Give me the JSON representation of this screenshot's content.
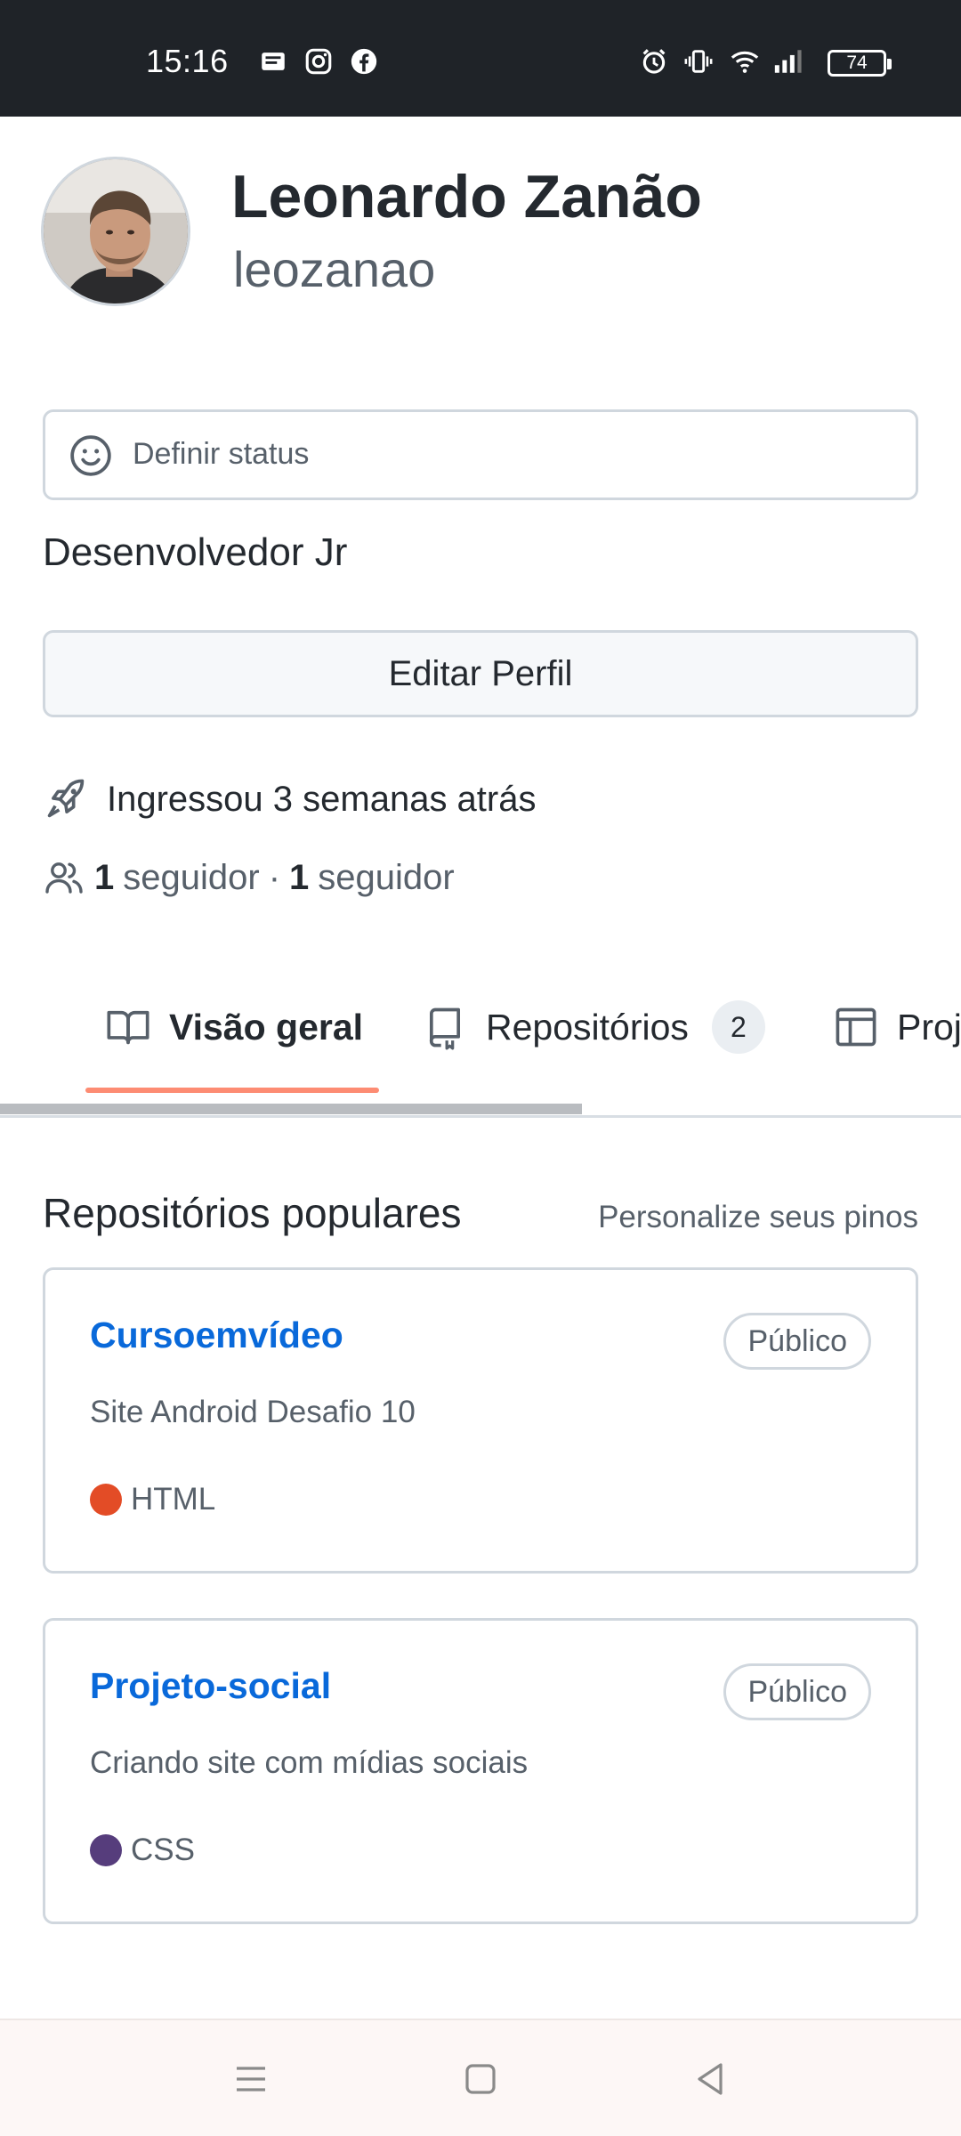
{
  "status_bar": {
    "time": "15:16",
    "notification_icons": [
      "message-icon",
      "instagram-icon",
      "facebook-icon"
    ],
    "system_icons": [
      "alarm-icon",
      "vibrate-icon",
      "wifi-icon",
      "signal-icon"
    ],
    "battery": "74"
  },
  "profile": {
    "name": "Leonardo Zanão",
    "login": "leozanao",
    "status_placeholder": "Definir status",
    "bio": "Desenvolvedor Jr",
    "edit_button": "Editar Perfil",
    "joined": "Ingressou 3 semanas atrás",
    "followers_count": "1",
    "followers_label": "seguidor",
    "following_count": "1",
    "following_label": "seguidor"
  },
  "tabs": [
    {
      "label": "Visão geral",
      "icon": "book-icon",
      "active": true
    },
    {
      "label": "Repositórios",
      "icon": "repo-icon",
      "count": "2"
    },
    {
      "label": "Proj",
      "icon": "table-icon"
    }
  ],
  "popular": {
    "title": "Repositórios populares",
    "customize_link": "Personalize seus pinos",
    "repos": [
      {
        "name": "Cursoemvídeo",
        "visibility": "Público",
        "description": "Site Android Desafio 10",
        "language": "HTML",
        "language_color": "#e34c26"
      },
      {
        "name": "Projeto-social",
        "visibility": "Público",
        "description": "Criando site com mídias sociais",
        "language": "CSS",
        "language_color": "#563d7c"
      }
    ]
  },
  "colors": {
    "accent_link": "#0969da",
    "tab_underline": "#fd8c73",
    "status_bar_bg": "#1f2328"
  }
}
